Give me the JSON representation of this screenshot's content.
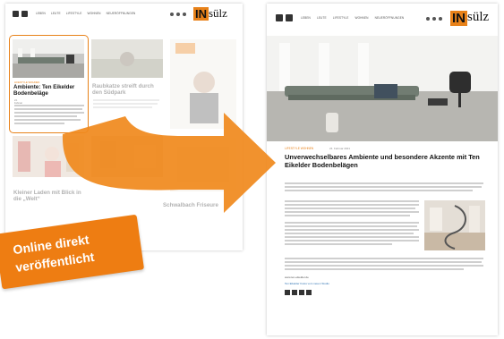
{
  "left_page": {
    "logo": {
      "in": "IN",
      "suelz": "sülz"
    },
    "nav": [
      "LEBEN",
      "LEUTE",
      "LIFESTYLE",
      "WOHNEN",
      "NEUERÖFFNUNGEN"
    ],
    "cards": [
      {
        "kicker": "LIFESTYLE  WOHNEN",
        "title": "Ambiente: Ten Eikelder Bodenbeläge",
        "date": "24. Februar 2021"
      },
      {
        "kicker": "",
        "title": "Raubkatze streift durch den Südpark",
        "date": ""
      },
      {
        "kicker": "",
        "title": "Kleiner Laden mit Blick in die „Welt“",
        "date": ""
      },
      {
        "kicker": "",
        "title": "Schwalbach Friseure",
        "date": ""
      }
    ]
  },
  "right_page": {
    "logo": {
      "in": "IN",
      "suelz": "sülz"
    },
    "nav": [
      "LEBEN",
      "LEUTE",
      "LIFESTYLE",
      "WOHNEN",
      "NEUERÖFFNUNGEN"
    ],
    "kicker": "LIFESTYLE  WOHNEN",
    "date": "24. Februar 2021",
    "title": "Unverwechselbares Ambiente und besondere Akzente mit Ten Eikelder Bodenbelägen",
    "link": "www.ten-eikelder.de",
    "link2": "Ten Eikelder Fotos vom neuen Studio"
  },
  "badge": {
    "line1": "Online direkt",
    "line2": "veröffentlicht"
  },
  "colors": {
    "accent": "#ee7d12",
    "arrow": "#f08a1e",
    "highlight": "#e8821a"
  }
}
